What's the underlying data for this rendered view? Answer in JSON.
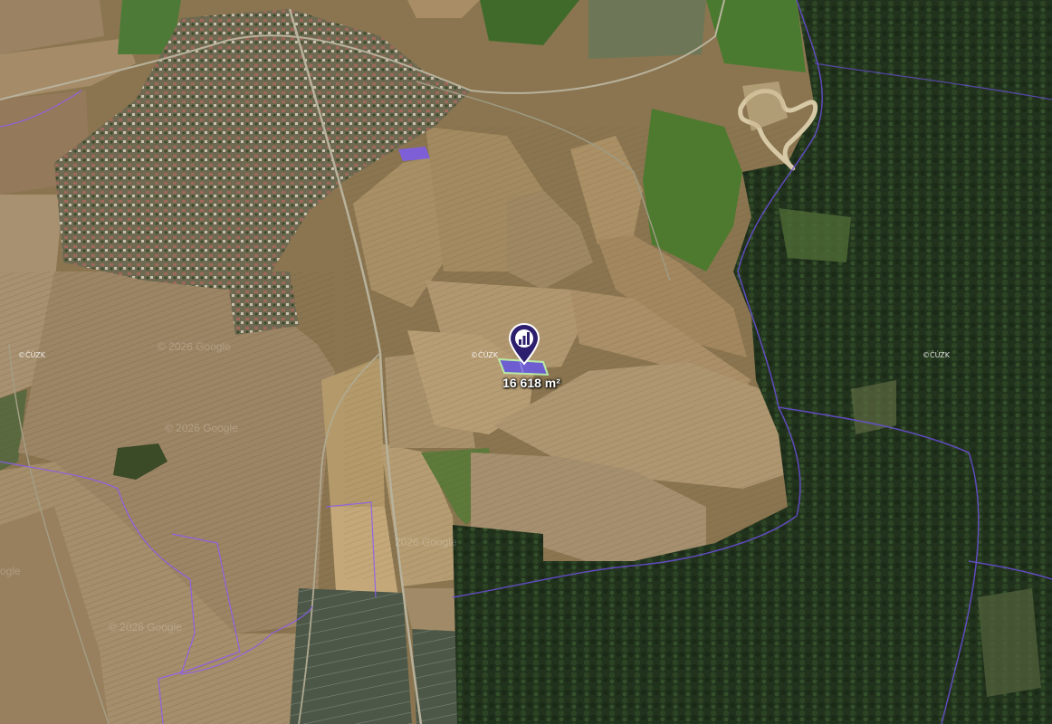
{
  "map": {
    "view": "satellite",
    "parcel": {
      "area_label": "16 618 m²",
      "pin_icon": "map-marker-icon",
      "highlight_color": "#6b5bd6",
      "outline_color": "#b9f0a8"
    },
    "boundary_color": "#8b5cf6",
    "watermarks": [
      {
        "text": "© 2026 Google"
      },
      {
        "text": "© 2026 Google"
      },
      {
        "text": "© 2026 Google"
      },
      {
        "text": "2026 Google"
      },
      {
        "text": "ogle"
      }
    ],
    "cuzk_tags": [
      {
        "text": "©ČÚZK"
      },
      {
        "text": "©ČÚZK"
      },
      {
        "text": "©ČÚZK"
      }
    ]
  }
}
